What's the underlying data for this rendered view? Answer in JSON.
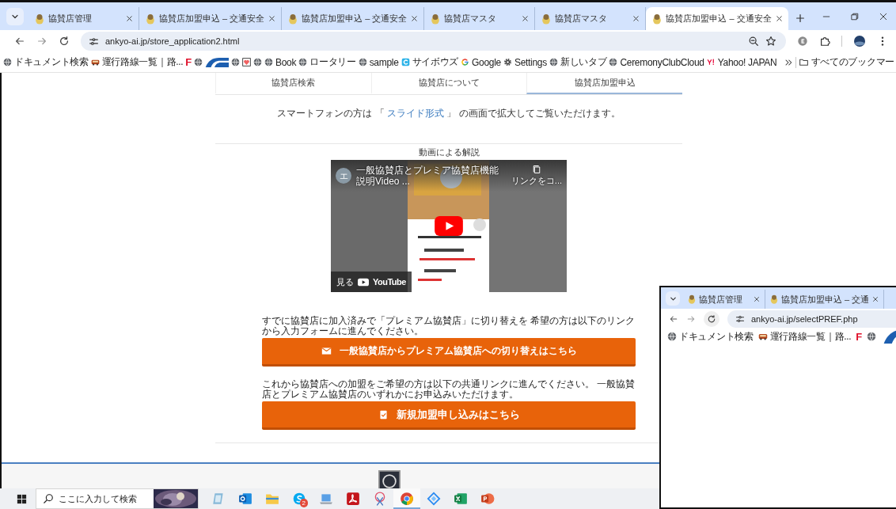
{
  "main_window": {
    "tabs": [
      {
        "title": "協賛店管理",
        "selected": false
      },
      {
        "title": "協賛店加盟申込 – 交通安全",
        "selected": false
      },
      {
        "title": "協賛店加盟申込 – 交通安全",
        "selected": false
      },
      {
        "title": "協賛店マスタ",
        "selected": false
      },
      {
        "title": "協賛店マスタ",
        "selected": false
      },
      {
        "title": "協賛店加盟申込 – 交通安全",
        "selected": true
      }
    ],
    "url": "ankyo-ai.jp/store_application2.html",
    "bookmarks": [
      {
        "kind": "globe",
        "label": "ドキュメント検索"
      },
      {
        "kind": "bus",
        "label": "運行路線一覧｜路..."
      },
      {
        "kind": "letter",
        "label": "F"
      },
      {
        "kind": "globe"
      },
      {
        "kind": "logo"
      },
      {
        "kind": "globe"
      },
      {
        "kind": "heart"
      },
      {
        "kind": "globe"
      },
      {
        "kind": "globe",
        "label": "Book"
      },
      {
        "kind": "globe",
        "label": "ロータリー"
      },
      {
        "kind": "globe",
        "label": "sample"
      },
      {
        "kind": "cybozu",
        "label": "サイボウズ"
      },
      {
        "kind": "google",
        "label": "Google"
      },
      {
        "kind": "gear",
        "label": "Settings"
      },
      {
        "kind": "globe",
        "label": "新しいタブ"
      },
      {
        "kind": "globe",
        "label": "CeremonyClubCloud"
      },
      {
        "kind": "yahoo",
        "label": "Yahoo! JAPAN"
      }
    ],
    "all_bookmarks": "すべてのブックマー"
  },
  "page": {
    "nav": [
      {
        "label": "協賛店検索",
        "selected": false
      },
      {
        "label": "協賛店について",
        "selected": false
      },
      {
        "label": "協賛店加盟申込",
        "selected": true
      }
    ],
    "notice": {
      "before": "スマートフォンの方は 「 ",
      "link": "スライド形式",
      "after": " 」 の画面で拡大してご覧いただけます。"
    },
    "video": {
      "caption": "動画による解説",
      "channel_initial": "エ",
      "title": "一般協賛店とプレミア協賛店機能説明Video ...",
      "copy_label": "リンクをコ...",
      "watch_label": "見る",
      "logo_label": "YouTube"
    },
    "sections": [
      {
        "text": "すでに協賛店に加入済みで「プレミアム協賛店」に切り替えを 希望の方は以下のリンクから入力フォームに進んでください。",
        "button": {
          "label": "一般協賛店からプレミアム協賛店への切り替えはこちら"
        }
      },
      {
        "text": "これから協賛店への加盟をご希望の方は以下の共通リンクに進んでください。 一般協賛店とプレミアム協賛店のいずれかにお申込みいただけます。",
        "button": {
          "label": "新規加盟申し込みはこちら"
        }
      }
    ]
  },
  "second_window": {
    "tabs": [
      {
        "title": "協賛店管理",
        "selected": false
      },
      {
        "title": "協賛店加盟申込 – 交通",
        "selected": false
      }
    ],
    "url": "ankyo-ai.jp/selectPREF.php",
    "bookmarks": [
      {
        "kind": "globe",
        "label": "ドキュメント検索"
      },
      {
        "kind": "bus",
        "label": "運行路線一覧｜路..."
      },
      {
        "kind": "letter",
        "label": "F"
      },
      {
        "kind": "globe"
      },
      {
        "kind": "logo"
      }
    ]
  },
  "taskbar": {
    "search_placeholder": "ここに入力して検索",
    "apps": [
      {
        "kind": "notepad",
        "selected": false
      },
      {
        "kind": "outlook",
        "selected": false
      },
      {
        "kind": "explorer",
        "selected": false
      },
      {
        "kind": "skype",
        "selected": false,
        "badge": "2"
      },
      {
        "kind": "laptop",
        "selected": false
      },
      {
        "kind": "acrobat",
        "selected": false
      },
      {
        "kind": "snip",
        "selected": false
      },
      {
        "kind": "chrome",
        "selected": true
      },
      {
        "kind": "diamond",
        "selected": false
      },
      {
        "kind": "excel",
        "selected": false
      },
      {
        "kind": "powerpoint",
        "selected": false
      }
    ]
  }
}
